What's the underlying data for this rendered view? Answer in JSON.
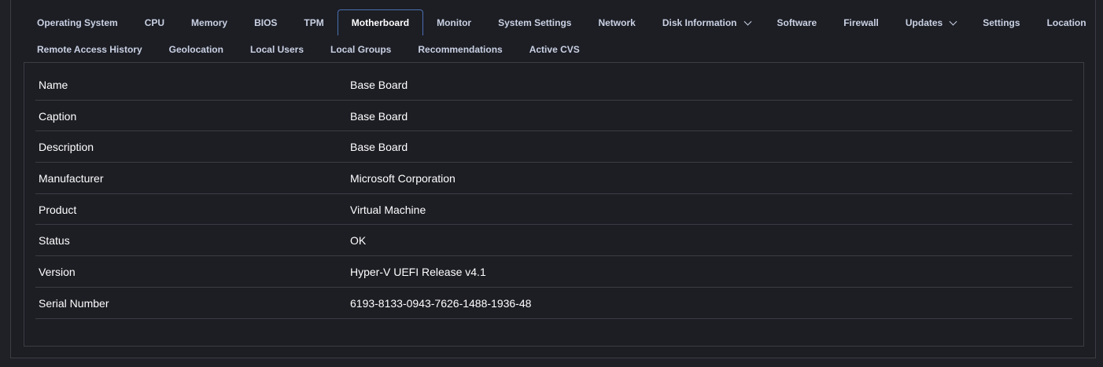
{
  "tabs_row1": [
    {
      "label": "Operating System",
      "active": false,
      "dropdown": false
    },
    {
      "label": "CPU",
      "active": false,
      "dropdown": false
    },
    {
      "label": "Memory",
      "active": false,
      "dropdown": false
    },
    {
      "label": "BIOS",
      "active": false,
      "dropdown": false
    },
    {
      "label": "TPM",
      "active": false,
      "dropdown": false
    },
    {
      "label": "Motherboard",
      "active": true,
      "dropdown": false
    },
    {
      "label": "Monitor",
      "active": false,
      "dropdown": false
    },
    {
      "label": "System Settings",
      "active": false,
      "dropdown": false
    },
    {
      "label": "Network",
      "active": false,
      "dropdown": false
    },
    {
      "label": "Disk Information",
      "active": false,
      "dropdown": true
    },
    {
      "label": "Software",
      "active": false,
      "dropdown": false
    },
    {
      "label": "Firewall",
      "active": false,
      "dropdown": false
    },
    {
      "label": "Updates",
      "active": false,
      "dropdown": true
    },
    {
      "label": "Settings",
      "active": false,
      "dropdown": false
    },
    {
      "label": "Location",
      "active": false,
      "dropdown": false
    }
  ],
  "tabs_row2": [
    {
      "label": "Remote Access History",
      "active": false,
      "dropdown": false
    },
    {
      "label": "Geolocation",
      "active": false,
      "dropdown": false
    },
    {
      "label": "Local Users",
      "active": false,
      "dropdown": false
    },
    {
      "label": "Local Groups",
      "active": false,
      "dropdown": false
    },
    {
      "label": "Recommendations",
      "active": false,
      "dropdown": false
    },
    {
      "label": "Active CVS",
      "active": false,
      "dropdown": false
    }
  ],
  "motherboard": [
    {
      "key": "Name",
      "value": "Base Board"
    },
    {
      "key": "Caption",
      "value": "Base Board"
    },
    {
      "key": "Description",
      "value": "Base Board"
    },
    {
      "key": "Manufacturer",
      "value": "Microsoft Corporation"
    },
    {
      "key": "Product",
      "value": "Virtual Machine"
    },
    {
      "key": "Status",
      "value": "OK"
    },
    {
      "key": "Version",
      "value": "Hyper-V UEFI Release v4.1"
    },
    {
      "key": "Serial Number",
      "value": "6193-8133-0943-7626-1488-1936-48"
    }
  ],
  "colors": {
    "background": "#202127",
    "panel": "#1d1e24",
    "border": "#3c3d44",
    "active_tab_border": "#4a6fb0",
    "tab_text": "#c9d1e4",
    "text": "#ffffff"
  },
  "icons": {
    "dropdown": "chevron-down-icon"
  }
}
